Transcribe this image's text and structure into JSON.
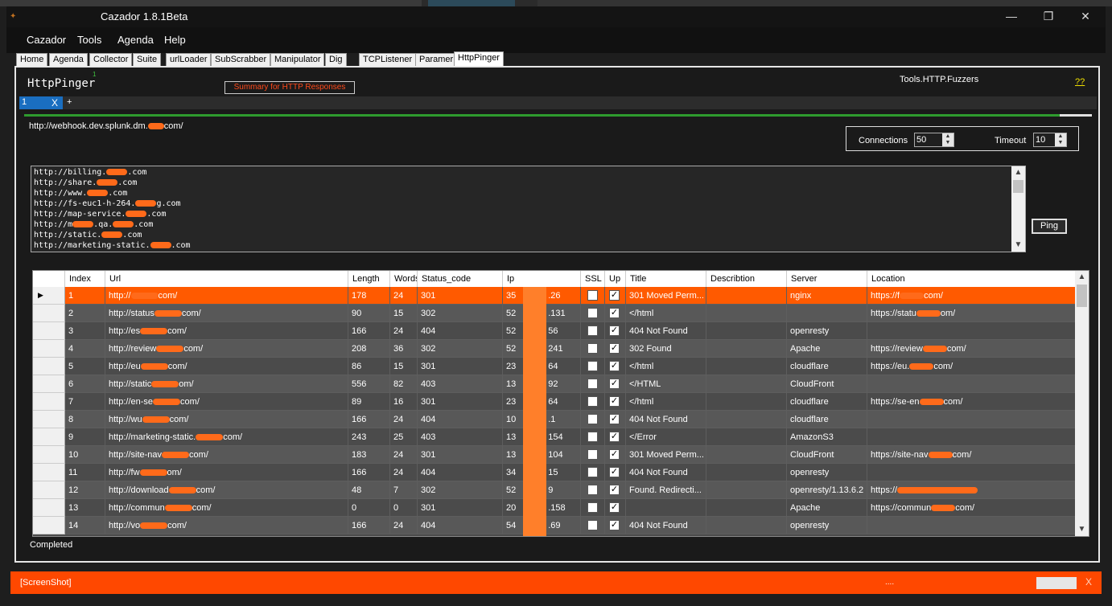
{
  "window": {
    "title": "Cazador 1.8.1Beta",
    "minimize_glyph": "—",
    "maximize_glyph": "❐",
    "close_glyph": "✕"
  },
  "menu": [
    "Cazador",
    "Tools",
    "Agenda",
    "Help"
  ],
  "tabs": [
    "Home",
    "Agenda",
    "Collector",
    "Suite",
    "urlLoader",
    "SubScrabber",
    "Manipulator",
    "Dig",
    "TCPListener",
    "Paramer",
    "HttpPinger"
  ],
  "active_tab": "HttpPinger",
  "panel": {
    "title": "HttpPinger",
    "title_sup": "1",
    "summary_button": "Summary for HTTP Responses",
    "fuzzers_label": "Tools.HTTP.Fuzzers",
    "help_link": "??",
    "subtab_num": "1",
    "subtab_close": "X",
    "subtab_add": "+",
    "progress": 0.97,
    "url_prefix": "http://webhook.dev.splunk.dm.",
    "url_suffix": "com/",
    "connections_label": "Connections",
    "connections_value": "50",
    "timeout_label": "Timeout",
    "timeout_value": "10",
    "ping_button": "Ping",
    "status": "Completed"
  },
  "host_lines": [
    [
      "http://billing.",
      ".com"
    ],
    [
      "http://share.",
      ".com"
    ],
    [
      "http://www.",
      ".com"
    ],
    [
      "http://fs-euc1-h-264.",
      "g.com"
    ],
    [
      "http://map-service.",
      ".com"
    ],
    [
      "http://m",
      ".qa.",
      ".com"
    ],
    [
      "http://static.",
      ".com"
    ],
    [
      "http://marketing-static.",
      ".com"
    ]
  ],
  "grid": {
    "columns": [
      "Index",
      "Url",
      "Length",
      "Words",
      "Status_code",
      "Ip",
      "SSL",
      "Up",
      "Title",
      "Describtion",
      "Server",
      "Location"
    ],
    "rows": [
      {
        "index": "1",
        "url_a": "http://",
        "url_b": "com/",
        "length": "178",
        "words": "24",
        "status": "301",
        "ip_a": "35",
        "ip_b": ".26",
        "ssl": false,
        "up": true,
        "title": "301 Moved Perm...",
        "desc": "",
        "server": "nginx",
        "loc_a": "https://f",
        "loc_b": "com/"
      },
      {
        "index": "2",
        "url_a": "http://status",
        "url_b": "com/",
        "length": "90",
        "words": "15",
        "status": "302",
        "ip_a": "52",
        "ip_b": ".131",
        "ssl": false,
        "up": true,
        "title": "</html",
        "desc": "",
        "server": "",
        "loc_a": "https://statu",
        "loc_b": "om/"
      },
      {
        "index": "3",
        "url_a": "http://es",
        "url_b": "com/",
        "length": "166",
        "words": "24",
        "status": "404",
        "ip_a": "52",
        "ip_b": "56",
        "ssl": false,
        "up": true,
        "title": "404 Not Found",
        "desc": "",
        "server": "openresty",
        "loc_a": "",
        "loc_b": ""
      },
      {
        "index": "4",
        "url_a": "http://review",
        "url_b": "com/",
        "length": "208",
        "words": "36",
        "status": "302",
        "ip_a": "52",
        "ip_b": "241",
        "ssl": false,
        "up": true,
        "title": "302 Found",
        "desc": "",
        "server": "Apache",
        "loc_a": "https://review",
        "loc_b": "com/"
      },
      {
        "index": "5",
        "url_a": "http://eu",
        "url_b": "com/",
        "length": "86",
        "words": "15",
        "status": "301",
        "ip_a": "23",
        "ip_b": "64",
        "ssl": false,
        "up": true,
        "title": "</html",
        "desc": "",
        "server": "cloudflare",
        "loc_a": "https://eu.",
        "loc_b": "com/"
      },
      {
        "index": "6",
        "url_a": "http://static",
        "url_b": "om/",
        "length": "556",
        "words": "82",
        "status": "403",
        "ip_a": "13",
        "ip_b": "92",
        "ssl": false,
        "up": true,
        "title": "</HTML",
        "desc": "",
        "server": "CloudFront",
        "loc_a": "",
        "loc_b": ""
      },
      {
        "index": "7",
        "url_a": "http://en-se",
        "url_b": "com/",
        "length": "89",
        "words": "16",
        "status": "301",
        "ip_a": "23",
        "ip_b": "64",
        "ssl": false,
        "up": true,
        "title": "</html",
        "desc": "",
        "server": "cloudflare",
        "loc_a": "https://se-en",
        "loc_b": "com/"
      },
      {
        "index": "8",
        "url_a": "http://wu",
        "url_b": "com/",
        "length": "166",
        "words": "24",
        "status": "404",
        "ip_a": "10",
        "ip_b": ".1",
        "ssl": false,
        "up": true,
        "title": "404 Not Found",
        "desc": "",
        "server": "cloudflare",
        "loc_a": "",
        "loc_b": ""
      },
      {
        "index": "9",
        "url_a": "http://marketing-static.",
        "url_b": "com/",
        "length": "243",
        "words": "25",
        "status": "403",
        "ip_a": "13",
        "ip_b": "154",
        "ssl": false,
        "up": true,
        "title": "</Error",
        "desc": "",
        "server": "AmazonS3",
        "loc_a": "",
        "loc_b": ""
      },
      {
        "index": "10",
        "url_a": "http://site-nav",
        "url_b": "com/",
        "length": "183",
        "words": "24",
        "status": "301",
        "ip_a": "13",
        "ip_b": "104",
        "ssl": false,
        "up": true,
        "title": "301 Moved Perm...",
        "desc": "",
        "server": "CloudFront",
        "loc_a": "https://site-nav",
        "loc_b": "com/"
      },
      {
        "index": "11",
        "url_a": "http://fw",
        "url_b": "om/",
        "length": "166",
        "words": "24",
        "status": "404",
        "ip_a": "34",
        "ip_b": "15",
        "ssl": false,
        "up": true,
        "title": "404 Not Found",
        "desc": "",
        "server": "openresty",
        "loc_a": "",
        "loc_b": ""
      },
      {
        "index": "12",
        "url_a": "http://download",
        "url_b": "com/",
        "length": "48",
        "words": "7",
        "status": "302",
        "ip_a": "52",
        "ip_b": "9",
        "ssl": false,
        "up": true,
        "title": "Found. Redirecti...",
        "desc": "",
        "server": "openresty/1.13.6.2",
        "loc_a": "https://",
        "loc_b": ""
      },
      {
        "index": "13",
        "url_a": "http://commun",
        "url_b": "com/",
        "length": "0",
        "words": "0",
        "status": "301",
        "ip_a": "20",
        "ip_b": ".158",
        "ssl": false,
        "up": true,
        "title": "",
        "desc": "",
        "server": "Apache",
        "loc_a": "https://commun",
        "loc_b": "com/"
      },
      {
        "index": "14",
        "url_a": "http://vo",
        "url_b": "com/",
        "length": "166",
        "words": "24",
        "status": "404",
        "ip_a": "54",
        "ip_b": ".69",
        "ssl": false,
        "up": true,
        "title": "404 Not Found",
        "desc": "",
        "server": "openresty",
        "loc_a": "",
        "loc_b": ""
      }
    ]
  },
  "bottombar": {
    "label": "[ScreenShot]",
    "dots": "....",
    "close": "X"
  },
  "colors": {
    "accent_orange": "#ff4800",
    "redaction": "#ff6a1a",
    "selected_row": "#ff5a00",
    "row_a": "#4b4b4b",
    "row_b": "#585858",
    "progress": "#2e9b2e"
  }
}
